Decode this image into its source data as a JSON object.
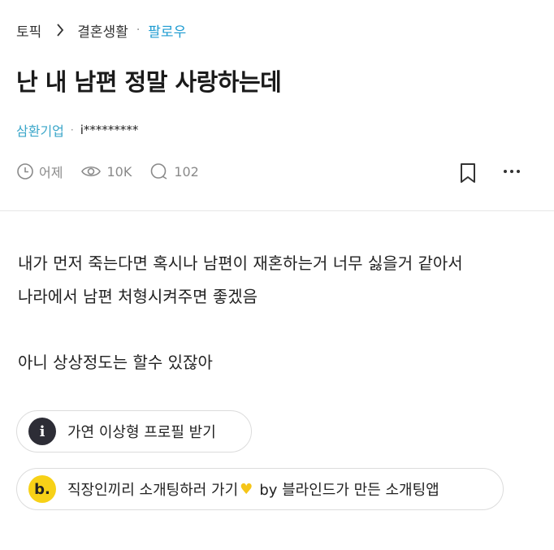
{
  "breadcrumb": {
    "topic": "토픽",
    "category": "결혼생활",
    "dot": "·",
    "follow": "팔로우"
  },
  "post": {
    "title": "난 내 남편 정말 사랑하는데",
    "company": "삼환기업",
    "author_dot": "·",
    "nickname": "i*********",
    "time": "어제",
    "views": "10K",
    "comments": "102",
    "body_line1": "내가 먼저 죽는다면 혹시나 남편이 재혼하는거 너무 싫을거 같아서",
    "body_line2": "나라에서 남편 처형시켜주면 좋겠음",
    "body_line3": "아니 상상정도는 할수 있잖아"
  },
  "promos": {
    "profile_icon": "i",
    "profile_label": "가연 이상형 프로필 받기",
    "dating_icon": "b.",
    "dating_label_a": "직장인끼리 소개팅하러 가기",
    "dating_label_b": "by 블라인드가 만든 소개팅앱",
    "heart_color": "#f5c518"
  }
}
